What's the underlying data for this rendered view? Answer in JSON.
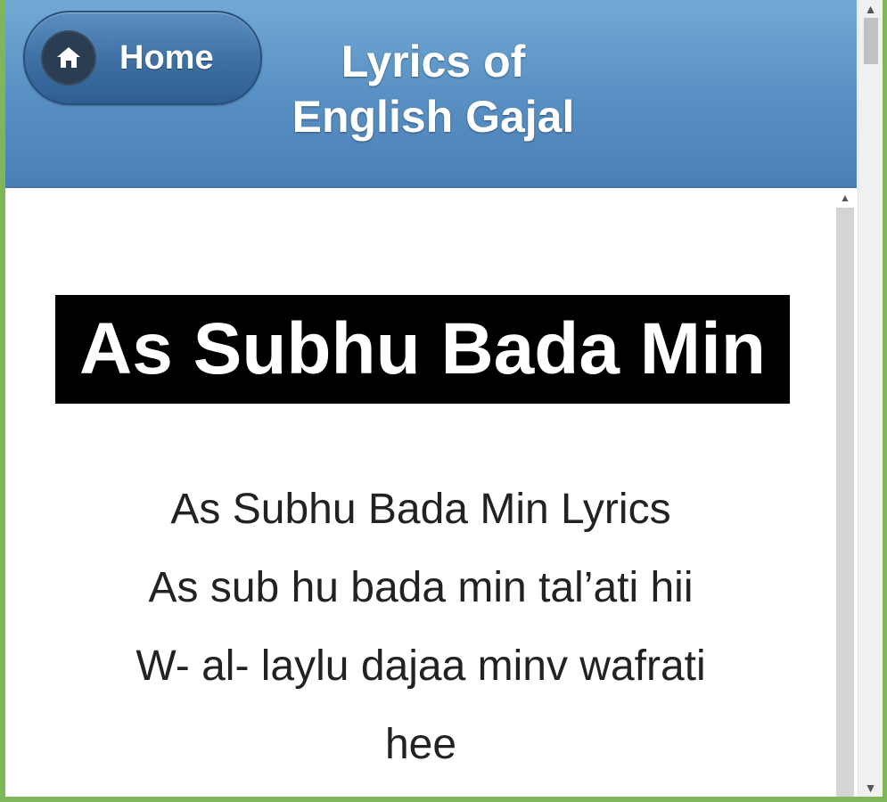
{
  "header": {
    "home_label": "Home",
    "title_line1": "Lyrics of",
    "title_line2": "English Gajal"
  },
  "content": {
    "song_title": "As Subhu Bada Min",
    "lyrics_lines": [
      "As Subhu Bada Min Lyrics",
      "As sub hu bada min tal’ati hii",
      "W- al- laylu dajaa minv wafrati",
      "hee"
    ]
  },
  "colors": {
    "header_top": "#72a9d4",
    "header_bottom": "#4a7fb6",
    "title_bg": "#000000",
    "title_text": "#ffffff",
    "body_text": "#222222",
    "window_border": "#7fb65a"
  },
  "icons": {
    "home": "home-icon",
    "scroll_up": "chevron-up-icon",
    "scroll_down": "chevron-down-icon"
  }
}
